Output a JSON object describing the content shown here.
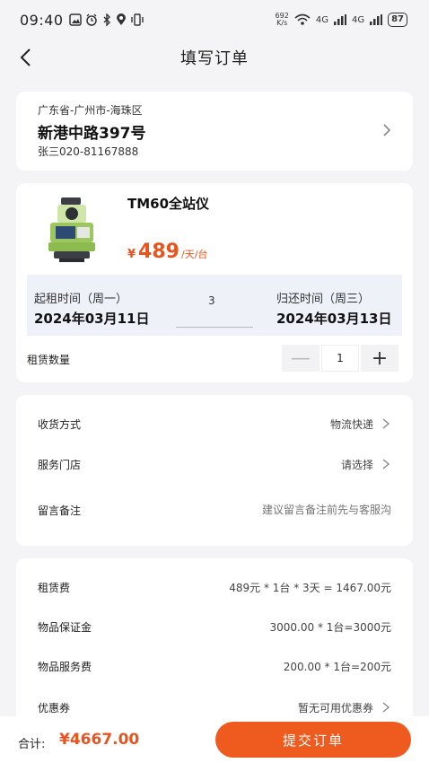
{
  "status": {
    "time": "09:40",
    "left_icons": [
      "image-icon",
      "alarm-icon",
      "bluetooth-icon",
      "location-icon",
      "vibrate-icon"
    ],
    "speed": "692\nK/s",
    "network": "4G",
    "battery": "87"
  },
  "nav": {
    "title": "填写订单"
  },
  "address": {
    "region": "广东省-广州市-海珠区",
    "street": "新港中路397号",
    "contact": "张三020-81167888"
  },
  "product": {
    "name": "TM60全站仪",
    "price_symbol": "¥",
    "price": "489",
    "price_unit": "/天/台",
    "start_label": "起租时间（周一）",
    "start_date": "2024年03月11日",
    "days": "3",
    "end_label": "归还时间（周三）",
    "end_date": "2024年03月13日",
    "qty_label": "租赁数量",
    "qty": "1",
    "minus": "—",
    "plus": "+"
  },
  "options": {
    "delivery_label": "收货方式",
    "delivery_value": "物流快递",
    "store_label": "服务门店",
    "store_value": "请选择",
    "note_label": "留言备注",
    "note_placeholder": "建议留言备注前先与客服沟"
  },
  "fees": {
    "rent_label": "租赁费",
    "rent_value": "489元 * 1台 * 3天 = 1467.00元",
    "deposit_label": "物品保证金",
    "deposit_value": "3000.00 * 1台=3000元",
    "service_label": "物品服务费",
    "service_value": "200.00 * 1台=200元",
    "coupon_label": "优惠券",
    "coupon_value": "暂无可用优惠券"
  },
  "footer": {
    "total_label": "合计:",
    "total_value": "¥4667.00",
    "submit": "提交订单"
  },
  "colors": {
    "accent": "#ef5a1f",
    "price": "#e9531d"
  }
}
